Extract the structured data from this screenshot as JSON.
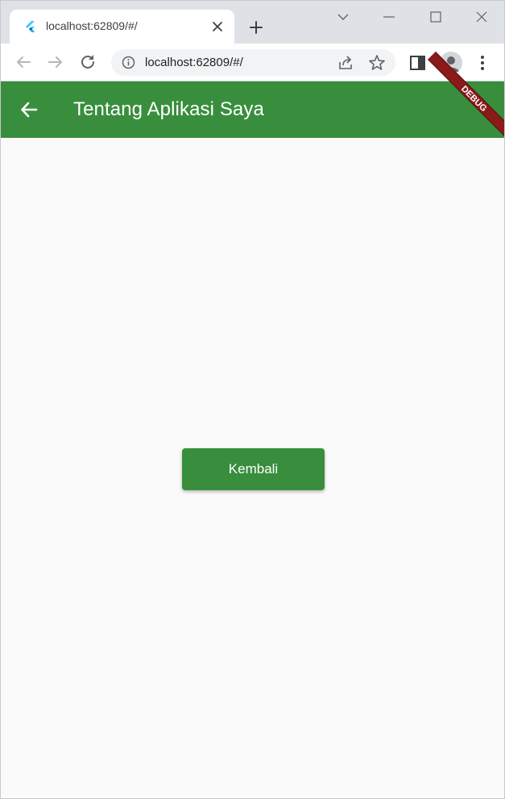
{
  "browser": {
    "tab": {
      "title": "localhost:62809/#/",
      "favicon": "flutter-icon"
    },
    "omnibox": {
      "url": "localhost:62809/#/"
    },
    "icons": {
      "back": "arrow-left-icon",
      "forward": "arrow-right-icon",
      "reload": "reload-icon",
      "info": "info-icon",
      "share": "share-icon",
      "star": "star-icon",
      "side_panel": "side-panel-icon",
      "profile": "profile-icon",
      "menu": "kebab-menu-icon"
    }
  },
  "app": {
    "appbar_title": "Tentang Aplikasi Saya",
    "debug_label": "DEBUG",
    "back_button_icon": "arrow-left-icon",
    "kembali_label": "Kembali",
    "colors": {
      "primary": "#388e3c",
      "background": "#fafafa",
      "on_primary": "#ffffff",
      "debug_banner": "#8b1a1a"
    }
  }
}
